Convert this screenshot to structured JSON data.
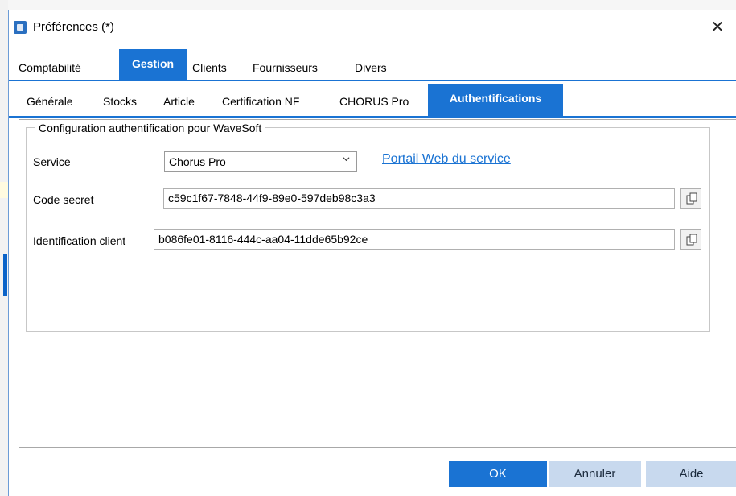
{
  "window": {
    "title": "Préférences (*)",
    "close_glyph": "✕"
  },
  "main_tabs": [
    {
      "label": "Comptabilité",
      "active": false
    },
    {
      "label": "Gestion",
      "active": true
    },
    {
      "label": "Clients",
      "active": false
    },
    {
      "label": "Fournisseurs",
      "active": false
    },
    {
      "label": "Divers",
      "active": false
    }
  ],
  "sub_tabs": [
    {
      "label": "Générale",
      "active": false
    },
    {
      "label": "Stocks",
      "active": false
    },
    {
      "label": "Article",
      "active": false
    },
    {
      "label": "Certification NF",
      "active": false
    },
    {
      "label": "CHORUS Pro",
      "active": false
    },
    {
      "label": "Authentifications",
      "active": true
    }
  ],
  "group": {
    "legend": "Configuration authentification pour WaveSoft",
    "service_label": "Service",
    "service_value": "Chorus Pro",
    "portal_link": "Portail Web du service",
    "secret_label": "Code secret",
    "secret_value": "c59c1f67-7848-44f9-89e0-597deb98c3a3",
    "client_label": "Identification client",
    "client_value": "b086fe01-8116-444c-aa04-11dde65b92ce"
  },
  "buttons": {
    "ok": "OK",
    "cancel": "Annuler",
    "help": "Aide"
  },
  "colors": {
    "accent": "#1a73d3",
    "secondary_button": "#c8d9ee"
  }
}
